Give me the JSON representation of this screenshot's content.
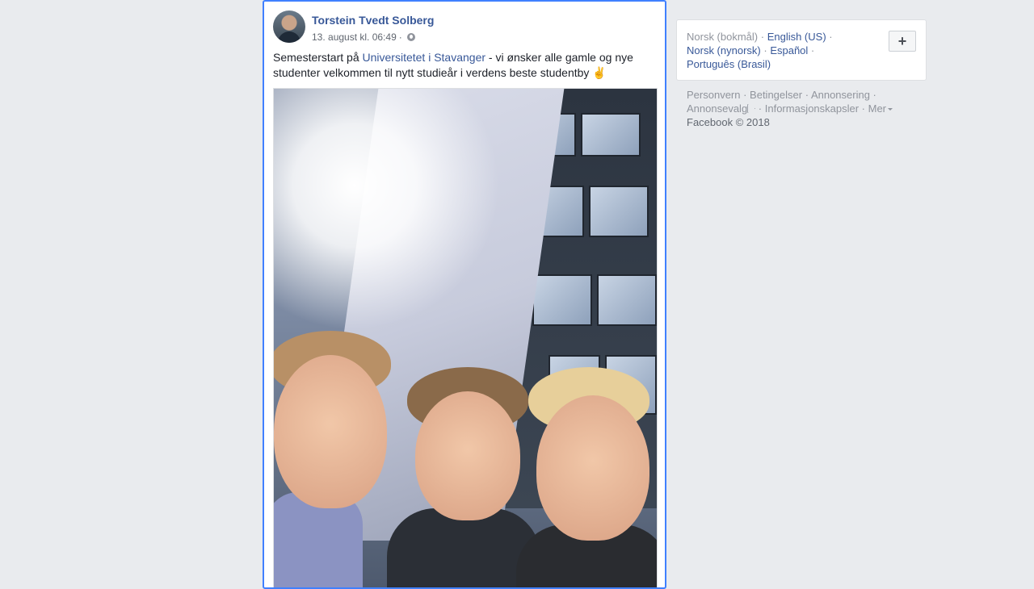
{
  "post": {
    "author": "Torstein Tvedt Solberg",
    "timestamp": "13. august kl. 06:49",
    "separator": "·",
    "audience_icon": "globe-icon",
    "text_before": "Semesterstart på ",
    "text_link": "Universitetet i Stavanger",
    "text_after": " - vi ønsker alle gamle og nye studenter velkommen til nytt studieår i verdens beste studentby",
    "emoji": "✌"
  },
  "languages": {
    "current": "Norsk (bokmål)",
    "options": [
      "English (US)",
      "Norsk (nynorsk)",
      "Español",
      "Português (Brasil)"
    ],
    "add_label": "+"
  },
  "footer": {
    "links": [
      "Personvern",
      "Betingelser",
      "Annonsering",
      "Annonsevalg",
      "Informasjonskapsler",
      "Mer"
    ],
    "copyright": "Facebook © 2018"
  },
  "colors": {
    "background": "#e9ebee",
    "link": "#385898",
    "focus_border": "#4080ff",
    "muted": "#90949c"
  }
}
